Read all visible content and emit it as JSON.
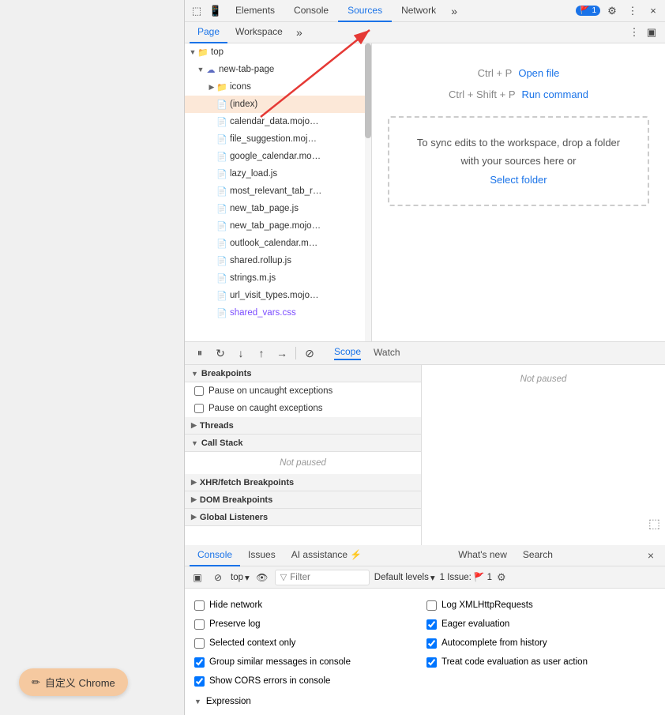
{
  "devtools": {
    "tabs": [
      {
        "label": "Elements",
        "active": false
      },
      {
        "label": "Console",
        "active": false
      },
      {
        "label": "Sources",
        "active": true
      },
      {
        "label": "Network",
        "active": false
      }
    ],
    "badge": "1",
    "source_tabs": [
      {
        "label": "Page",
        "active": true
      },
      {
        "label": "Workspace",
        "active": false
      }
    ],
    "file_tree": {
      "items": [
        {
          "level": 0,
          "type": "folder",
          "label": "top",
          "expanded": true,
          "arrow": "▼"
        },
        {
          "level": 1,
          "type": "cloud-folder",
          "label": "new-tab-page",
          "expanded": true,
          "arrow": "▼"
        },
        {
          "level": 2,
          "type": "folder",
          "label": "icons",
          "expanded": false,
          "arrow": "▶"
        },
        {
          "level": 2,
          "type": "file",
          "label": "(index)",
          "selected": true,
          "arrow": ""
        },
        {
          "level": 2,
          "type": "file",
          "label": "calendar_data.mojo…",
          "arrow": ""
        },
        {
          "level": 2,
          "type": "file",
          "label": "file_suggestion.moj…",
          "arrow": ""
        },
        {
          "level": 2,
          "type": "file",
          "label": "google_calendar.mo…",
          "arrow": ""
        },
        {
          "level": 2,
          "type": "file",
          "label": "lazy_load.js",
          "arrow": ""
        },
        {
          "level": 2,
          "type": "file",
          "label": "most_relevant_tab_r…",
          "arrow": ""
        },
        {
          "level": 2,
          "type": "file",
          "label": "new_tab_page.js",
          "arrow": ""
        },
        {
          "level": 2,
          "type": "file",
          "label": "new_tab_page.mojo…",
          "arrow": ""
        },
        {
          "level": 2,
          "type": "file",
          "label": "outlook_calendar.m…",
          "arrow": ""
        },
        {
          "level": 2,
          "type": "file",
          "label": "shared.rollup.js",
          "arrow": ""
        },
        {
          "level": 2,
          "type": "file",
          "label": "strings.m.js",
          "arrow": ""
        },
        {
          "level": 2,
          "type": "file",
          "label": "url_visit_types.mojo…",
          "arrow": ""
        },
        {
          "level": 2,
          "type": "file",
          "label": "shared_vars.css",
          "arrow": "",
          "color": "#7c4dff"
        }
      ]
    },
    "editor": {
      "shortcut1_key": "Ctrl + P",
      "shortcut1_label": "Open file",
      "shortcut2_key": "Ctrl + Shift + P",
      "shortcut2_label": "Run command",
      "workspace_text": "To sync edits to the workspace, drop a folder with your sources here or",
      "select_folder": "Select folder"
    },
    "debugger": {
      "toolbar_icons": [
        "pause",
        "step-over",
        "step-into",
        "step-out",
        "step",
        "deactivate"
      ],
      "scope_tabs": [
        {
          "label": "Scope",
          "active": true
        },
        {
          "label": "Watch",
          "active": false
        }
      ],
      "not_paused": "Not paused",
      "sections": [
        {
          "label": "Breakpoints",
          "expanded": true,
          "arrow": "▼",
          "options": [
            {
              "label": "Pause on uncaught exceptions",
              "checked": false
            },
            {
              "label": "Pause on caught exceptions",
              "checked": false
            }
          ]
        },
        {
          "label": "Threads",
          "expanded": false,
          "arrow": "▶"
        },
        {
          "label": "Call Stack",
          "expanded": true,
          "arrow": "▼",
          "not_paused": "Not paused"
        },
        {
          "label": "XHR/fetch Breakpoints",
          "expanded": false,
          "arrow": "▶"
        },
        {
          "label": "DOM Breakpoints",
          "expanded": false,
          "arrow": "▶"
        },
        {
          "label": "Global Listeners",
          "expanded": false,
          "arrow": "▶"
        }
      ]
    },
    "console": {
      "tabs": [
        {
          "label": "Console",
          "active": true
        },
        {
          "label": "Issues",
          "active": false
        },
        {
          "label": "AI assistance ⚡",
          "active": false
        },
        {
          "label": "What's new",
          "active": false
        },
        {
          "label": "Search",
          "active": false
        }
      ],
      "close_label": "×",
      "filter_bar": {
        "context_label": "top",
        "filter_placeholder": "Filter",
        "levels_label": "Default levels",
        "issue_count": "1 Issue:",
        "issue_badge_num": "1"
      },
      "options": [
        {
          "label": "Hide network",
          "checked": false,
          "col": 1
        },
        {
          "label": "Log XMLHttpRequests",
          "checked": false,
          "col": 2
        },
        {
          "label": "Preserve log",
          "checked": false,
          "col": 1
        },
        {
          "label": "Eager evaluation",
          "checked": true,
          "col": 2
        },
        {
          "label": "Selected context only",
          "checked": false,
          "col": 1
        },
        {
          "label": "Autocomplete from history",
          "checked": true,
          "col": 2
        },
        {
          "label": "Group similar messages in console",
          "checked": true,
          "col": 1
        },
        {
          "label": "Treat code evaluation as user action",
          "checked": true,
          "col": 2
        },
        {
          "label": "Show CORS errors in console",
          "checked": true,
          "col": 1
        }
      ],
      "expression_label": "Expression"
    }
  },
  "customize_btn_label": "自定义 Chrome",
  "icons": {
    "pencil": "✏",
    "close": "×",
    "gear": "⚙",
    "more": "⋮",
    "menu": "☰",
    "inspect": "⬚",
    "device": "📱",
    "search": "🔍",
    "filter": "⊘",
    "eye": "👁",
    "filter_funnel": "▽",
    "chevron_down": "▾",
    "pause": "⏸",
    "step_over": "↷",
    "step_into": "↓",
    "step_out": "↑",
    "step": "→",
    "deactivate": "⊗",
    "panel": "▣"
  }
}
